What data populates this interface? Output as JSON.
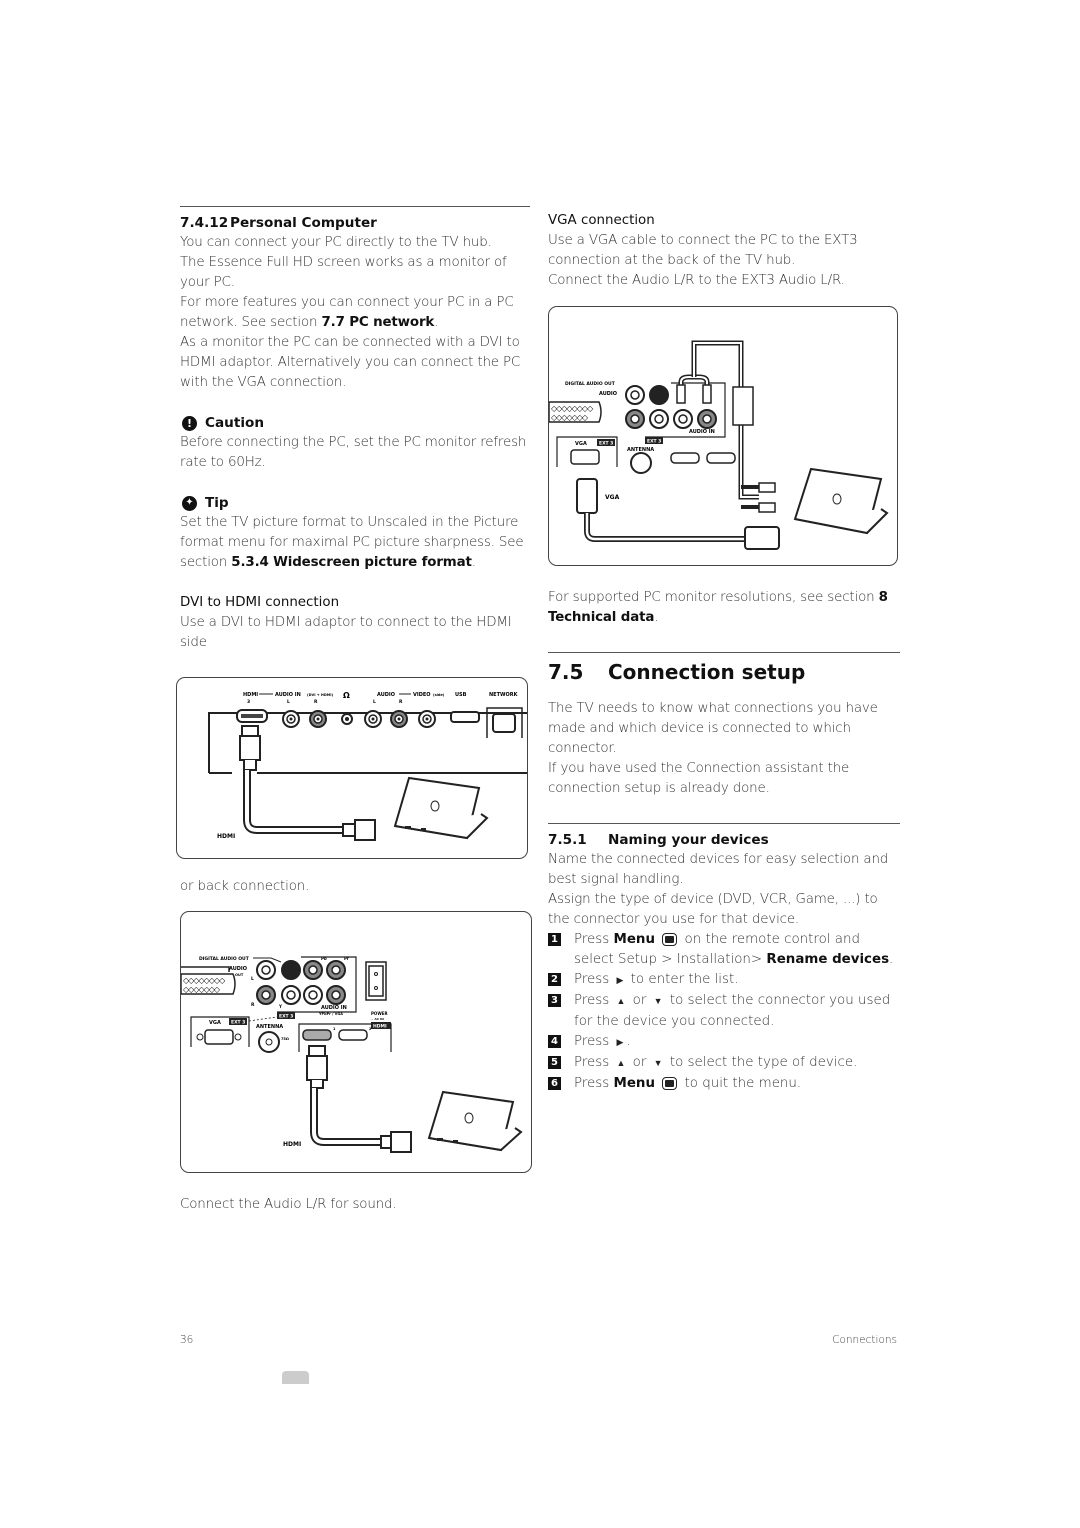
{
  "left_column": {
    "section_number": "7.4.12",
    "section_title": "Personal Computer",
    "intro_lines": [
      "You can connect your PC directly to the TV hub.",
      "The Essence Full HD screen works as a monitor of your PC."
    ],
    "network_text_before": "For more features you can connect your PC in a PC network. See section ",
    "network_link": "7.7 PC network",
    "network_text_after": ".",
    "monitor_text": "As a monitor the PC can be connected with a DVI to HDMI adaptor.  Alternatively you can connect the PC with the VGA connection.",
    "caution": {
      "icon": "exclamation-icon",
      "icon_glyph": "!",
      "title": "Caution",
      "text": "Before connecting the PC, set the PC monitor refresh rate to 60Hz."
    },
    "tip": {
      "icon": "tip-star-icon",
      "icon_glyph": "✦",
      "title": "Tip",
      "text_before": "Set the TV picture format to Unscaled in the Picture format menu for maximal PC picture sharpness. See section ",
      "link": "5.3.4 Widescreen picture format",
      "text_after": "."
    },
    "dvi_heading": "DVI to HDMI connection",
    "dvi_text": "Use a DVI to HDMI adaptor to connect to the HDMI side",
    "side_diagram": {
      "labels": {
        "hdmi": "HDMI",
        "hdmi_num": "3",
        "audio_in": "AUDIO IN",
        "audio_in_sub": "(DVI + HDMI)",
        "l": "L",
        "r": "R",
        "audio": "AUDIO",
        "video": "VIDEO",
        "video_sub": "(side)",
        "usb": "USB",
        "network": "NETWORK",
        "cable_label": "HDMI"
      }
    },
    "back_text": "or back connection.",
    "back_diagram": {
      "labels": {
        "digital_audio_out": "DIGITAL AUDIO OUT",
        "audio_out": "AUDIO",
        "out": "OUT",
        "l": "L",
        "r": "R",
        "pb": "Pb",
        "pr": "Pr",
        "y": "Y",
        "vga": "VGA",
        "ext3": "EXT 3",
        "audio_in": "AUDIO IN",
        "ypbpr_vga": "YPbPr / VGA",
        "antenna": "ANTENNA",
        "ohm": "75Ω",
        "hdmi_1": "1",
        "hdmi_2": "2",
        "power": "POWER",
        "ac_in": "~ AC IN",
        "hdmi": "HDMI",
        "cable_label": "HDMI"
      }
    },
    "sound_text": "Connect the Audio L/R for sound."
  },
  "right_column": {
    "vga_heading": "VGA connection",
    "vga_text": "Use a VGA cable to connect the PC to the EXT3 connection at the back of the TV hub.",
    "vga_audio_text": "Connect the Audio L/R to the EXT3 Audio L/R.",
    "vga_diagram": {
      "labels": {
        "cable_label": "VGA"
      }
    },
    "resolutions_before": "For supported PC monitor resolutions, see section ",
    "resolutions_link": "8 Technical data",
    "resolutions_after": ".",
    "section_number": "7.5",
    "section_title": "Connection setup",
    "setup_text": "The TV needs to know what connections you have made and which device is connected to which connector.",
    "assistant_text": "If you have used the Connection assistant the connection setup is already done.",
    "sub_number": "7.5.1",
    "sub_title": "Naming your devices",
    "naming_text": "Name the connected devices for easy selection and best signal handling.",
    "assign_text": "Assign the type of device (DVD, VCR, Game, ...) to the connector you use for that device.",
    "steps": [
      {
        "num": "1",
        "a": "Press ",
        "menu": "Menu",
        "b": " on the remote control and select Setup > Installation> ",
        "bold": "Rename devices",
        "c": "."
      },
      {
        "num": "2",
        "a": "Press ",
        "arrow1": "▶",
        "b": " to enter the list."
      },
      {
        "num": "3",
        "a": "Press ",
        "arrow1": "▲",
        "or": " or ",
        "arrow2": "▼",
        "b": " to select the connector you used for the device you connected."
      },
      {
        "num": "4",
        "a": "Press ",
        "arrow1": "▶",
        "b": "."
      },
      {
        "num": "5",
        "a": "Press ",
        "arrow1": "▲",
        "or": " or ",
        "arrow2": "▼",
        "b": " to select the type of device."
      },
      {
        "num": "6",
        "a": "Press ",
        "menu": "Menu",
        "b": " to quit the menu."
      }
    ]
  },
  "footer": {
    "page_number": "36",
    "chapter": "Connections"
  }
}
